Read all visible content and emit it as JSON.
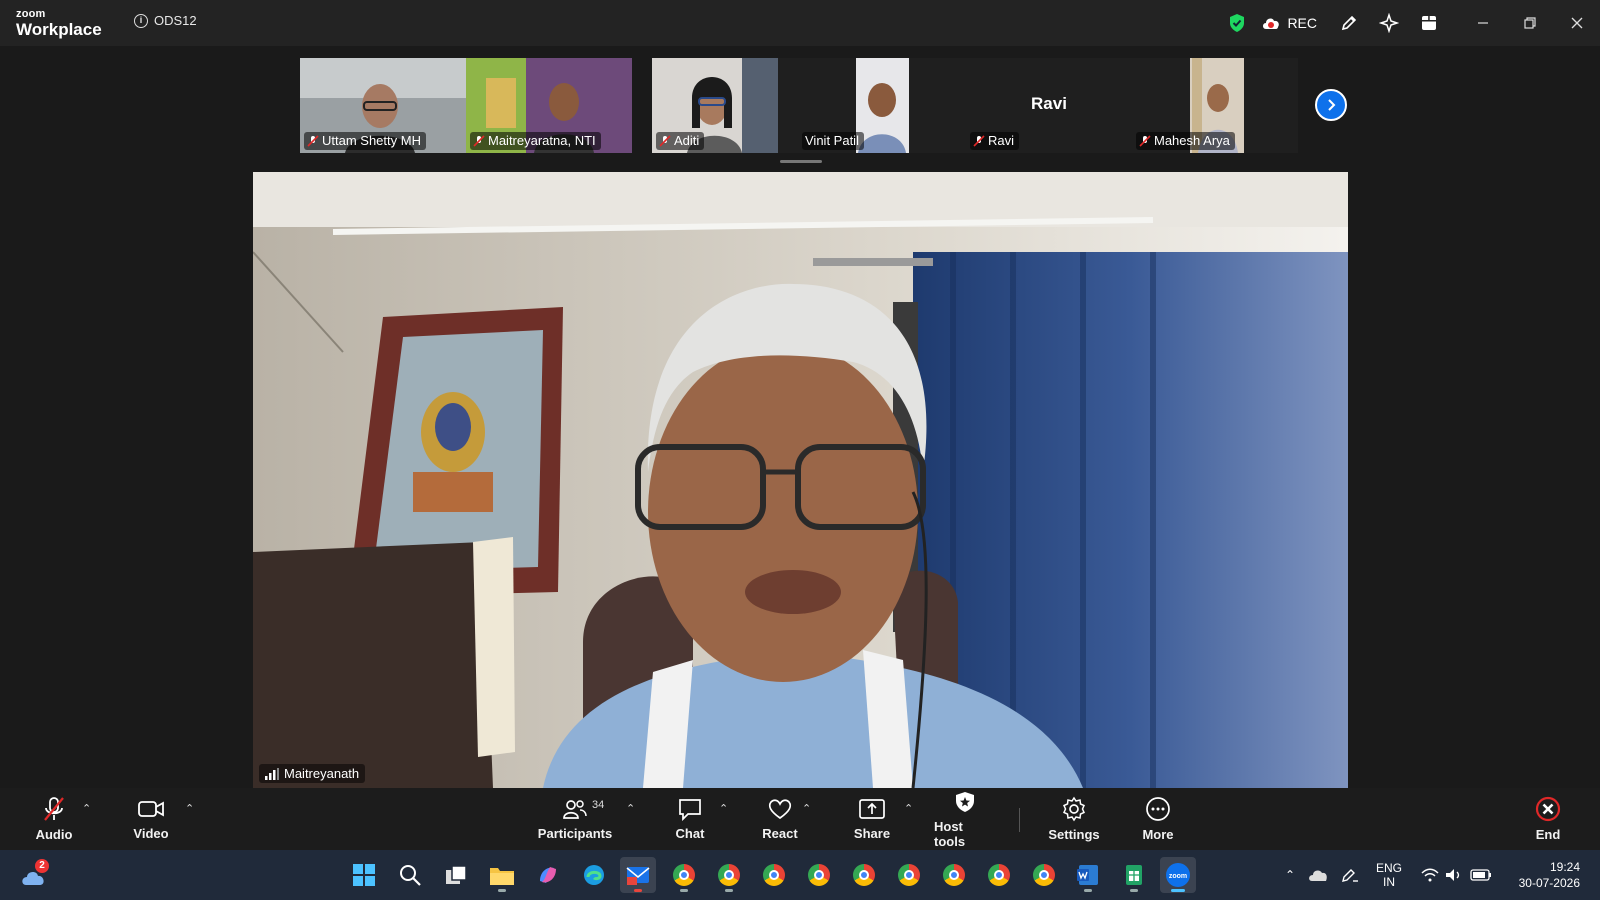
{
  "app": {
    "brand_small": "zoom",
    "brand_large": "Workplace",
    "meeting_id": "ODS12"
  },
  "titlebar": {
    "rec_label": "REC",
    "colors": {
      "shield": "#1ed760",
      "bg": "#232323"
    }
  },
  "gallery": [
    {
      "name": "Uttam Shetty MH",
      "muted": true
    },
    {
      "name": "Maitreyaratna, NTI",
      "muted": true
    },
    {
      "name": "Aditi",
      "muted": true
    },
    {
      "name": "Vinit Patil",
      "muted": false
    },
    {
      "name": "Ravi",
      "muted": true,
      "center_text": "Ravi"
    },
    {
      "name": "Mahesh Arya",
      "muted": true
    }
  ],
  "main_video": {
    "speaker_name": "Maitreyanath"
  },
  "toolbar": {
    "audio": "Audio",
    "video": "Video",
    "participants": "Participants",
    "participants_count": "34",
    "chat": "Chat",
    "react": "React",
    "share": "Share",
    "host_tools": "Host tools",
    "settings": "Settings",
    "more": "More",
    "end": "End",
    "colors": {
      "end": "#e02828",
      "accent": "#0e71eb"
    }
  },
  "taskbar": {
    "weather_badge": "2",
    "language_line1": "ENG",
    "language_line2": "IN",
    "time": "19:24",
    "date": "30-07-2026"
  }
}
